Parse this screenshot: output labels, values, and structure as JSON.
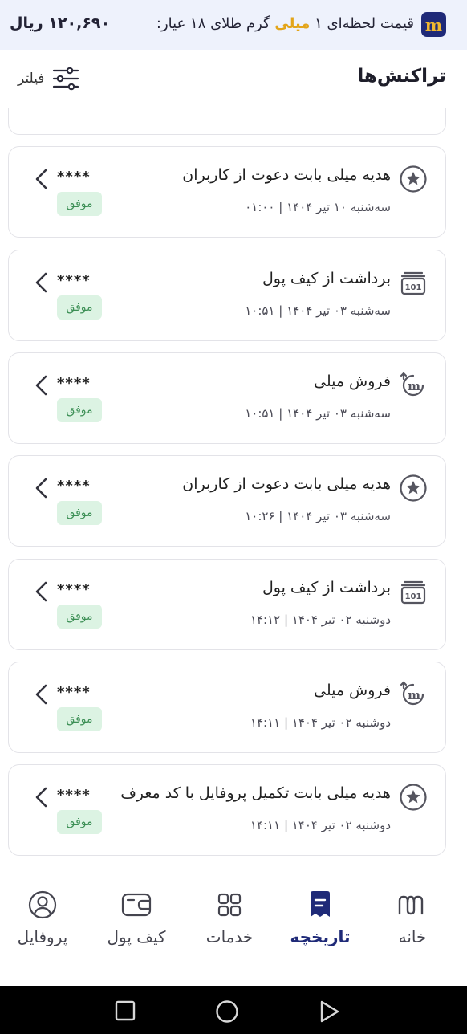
{
  "price_bar": {
    "price_value": "۱۲۰,۶۹۰ ریال",
    "label_before": "قیمت لحظه‌ای ۱",
    "label_highlight": "میلی",
    "label_after": "گرم طلای ۱۸ عیار:",
    "logo_letter": "m"
  },
  "header": {
    "title": "تراکنش‌ها",
    "filter_label": "فیلتر"
  },
  "transactions": [
    {
      "icon": "star-icon",
      "title": "هدیه میلی بابت دعوت از کاربران",
      "date": "سه‌شنبه ۱۰ تیر ۱۴۰۴ | ۰۱:۰۰",
      "amount": "****",
      "status": "موفق"
    },
    {
      "icon": "withdraw-wallet-icon",
      "title": "برداشت از کیف پول",
      "date": "سه‌شنبه ۰۳ تیر ۱۴۰۴ | ۱۰:۵۱",
      "amount": "****",
      "status": "موفق"
    },
    {
      "icon": "sell-milli-icon",
      "title": "فروش میلی",
      "date": "سه‌شنبه ۰۳ تیر ۱۴۰۴ | ۱۰:۵۱",
      "amount": "****",
      "status": "موفق"
    },
    {
      "icon": "star-icon",
      "title": "هدیه میلی بابت دعوت از کاربران",
      "date": "سه‌شنبه ۰۳ تیر ۱۴۰۴ | ۱۰:۲۶",
      "amount": "****",
      "status": "موفق"
    },
    {
      "icon": "withdraw-wallet-icon",
      "title": "برداشت از کیف پول",
      "date": "دوشنبه ۰۲ تیر ۱۴۰۴ | ۱۴:۱۲",
      "amount": "****",
      "status": "موفق"
    },
    {
      "icon": "sell-milli-icon",
      "title": "فروش میلی",
      "date": "دوشنبه ۰۲ تیر ۱۴۰۴ | ۱۴:۱۱",
      "amount": "****",
      "status": "موفق"
    },
    {
      "icon": "star-icon",
      "title": "هدیه میلی بابت تکمیل پروفایل با کد معرف",
      "date": "دوشنبه ۰۲ تیر ۱۴۰۴ | ۱۴:۱۱",
      "amount": "****",
      "status": "موفق"
    }
  ],
  "bottom_nav": [
    {
      "key": "home",
      "label": "خانه",
      "icon": "milli-logo-icon",
      "active": false
    },
    {
      "key": "history",
      "label": "تاریخچه",
      "icon": "receipt-icon",
      "active": true
    },
    {
      "key": "services",
      "label": "خدمات",
      "icon": "grid-icon",
      "active": false
    },
    {
      "key": "wallet",
      "label": "کیف پول",
      "icon": "wallet-icon",
      "active": false
    },
    {
      "key": "profile",
      "label": "پروفایل",
      "icon": "user-circle-icon",
      "active": false
    }
  ],
  "system_nav": [
    "square-icon",
    "circle-icon",
    "triangle-back-icon"
  ],
  "colors": {
    "brand_navy": "#1f2a78",
    "highlight_gold": "#e3a51a",
    "success_bg": "#dcf3e3",
    "success_text": "#3c8f55",
    "price_bar_bg": "#eef2fc"
  }
}
